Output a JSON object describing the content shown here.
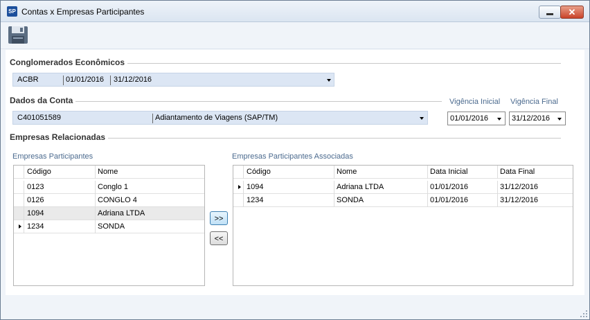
{
  "window": {
    "title": "Contas x Empresas Participantes",
    "app_icon_text": "SP",
    "close_symbol": "✕"
  },
  "conglomerados": {
    "label": "Conglomerados Econômicos",
    "code": "ACBR",
    "date_start": "01/01/2016",
    "date_end": "31/12/2016"
  },
  "dados_conta": {
    "label": "Dados da Conta",
    "account_code": "C401051589",
    "account_name": "Adiantamento de Viagens (SAP/TM)",
    "vigencia_inicial_label": "Vigência Inicial",
    "vigencia_inicial": "01/01/2016",
    "vigencia_final_label": "Vigência Final",
    "vigencia_final": "31/12/2016"
  },
  "empresas_relacionadas": {
    "label": "Empresas Relacionadas"
  },
  "participantes": {
    "label": "Empresas Participantes",
    "headers": {
      "codigo": "Código",
      "nome": "Nome"
    },
    "rows": [
      {
        "codigo": "0123",
        "nome": "Conglo 1"
      },
      {
        "codigo": "0126",
        "nome": "CONGLO 4"
      },
      {
        "codigo": "1094",
        "nome": "Adriana LTDA"
      },
      {
        "codigo": "1234",
        "nome": "SONDA"
      }
    ]
  },
  "associadas": {
    "label": "Empresas Participantes Associadas",
    "headers": {
      "codigo": "Código",
      "nome": "Nome",
      "data_inicial": "Data Inicial",
      "data_final": "Data Final"
    },
    "rows": [
      {
        "codigo": "1094",
        "nome": "Adriana LTDA",
        "data_inicial": "01/01/2016",
        "data_final": "31/12/2016"
      },
      {
        "codigo": "1234",
        "nome": "SONDA",
        "data_inicial": "01/01/2016",
        "data_final": "31/12/2016"
      }
    ]
  },
  "buttons": {
    "add": ">>",
    "remove": "<<"
  },
  "colors": {
    "accent": "#dce6f4",
    "title_bar": "#dbe5f1",
    "close": "#c9432a"
  }
}
